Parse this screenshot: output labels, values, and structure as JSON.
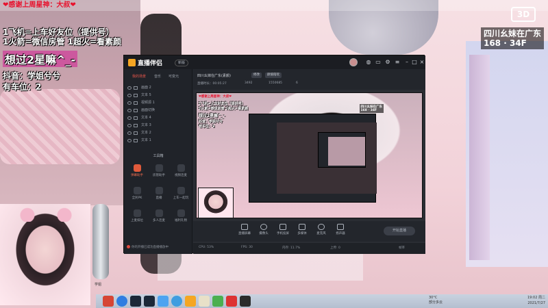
{
  "overlay": {
    "ticker": "❤感谢上周星神：大叔❤",
    "line1": "1飞机=上车好友位（提供号）",
    "line2": "1火箭=微信房管  1超火=看素颜",
    "line3": "想过2星嘛^_-",
    "line4": "抖音：学姐兮兮",
    "line5": "有车位：2",
    "location": "四川幺妹在广东\n168 · 34F",
    "logo": "3D"
  },
  "app": {
    "brand": "直播伴侣",
    "version_pill": "新版",
    "left_tabs": [
      "我的场景",
      "音乐",
      "可变元"
    ],
    "sources": [
      "画面 2",
      "文本 5",
      "视频源 1",
      "画面切换",
      "文本 4",
      "文本 3",
      "文本 2",
      "文本 1"
    ],
    "tools_title": "工具箱",
    "tools": [
      "弹幕助手",
      "房管助手",
      "视频连麦",
      "全民PK",
      "直播",
      "上车一起玩",
      "上麦排位",
      "多人连麦",
      "福利礼物"
    ],
    "footer_text": "你的开播已成功直播播放中",
    "room_title": "四川幺妹在广东(素颜)",
    "edit_label": "修改",
    "category_label": "颜值陪玩",
    "room_meta": "直播时长：00:05:27",
    "meta_values": [
      "3492",
      "1550685",
      "6"
    ],
    "controls": [
      "直播屏幕",
      "摄像头",
      "手机投屏",
      "多媒体",
      "麦克风",
      "扬声器"
    ],
    "live_button": "开始直播",
    "status_items": [
      "CPU: 53%",
      "FPS: 30",
      "内存: 11.7%",
      "上传: 0",
      "帧率"
    ],
    "preview_text": {
      "red": "❤感谢上周星神：大叔❤",
      "l1": "1飞机=上车好友位（提供号）",
      "l2": "1火箭=微信房管 1超火=看素颜",
      "l3": "想过2星嘛^_-",
      "l4": "抖音：学姐兮兮",
      "l5": "有车位：2",
      "loc": "四川幺妹在广东\n168 · 34F"
    }
  },
  "taskbar": {
    "weather": "30°C\n部分多云",
    "time": "19:02 周二",
    "date": "2021/7/27"
  },
  "cam_label": "学姐",
  "colors": {
    "ticker_red": "#e8112c",
    "accent_orange": "#f5a623",
    "app_bg": "#22252b"
  }
}
